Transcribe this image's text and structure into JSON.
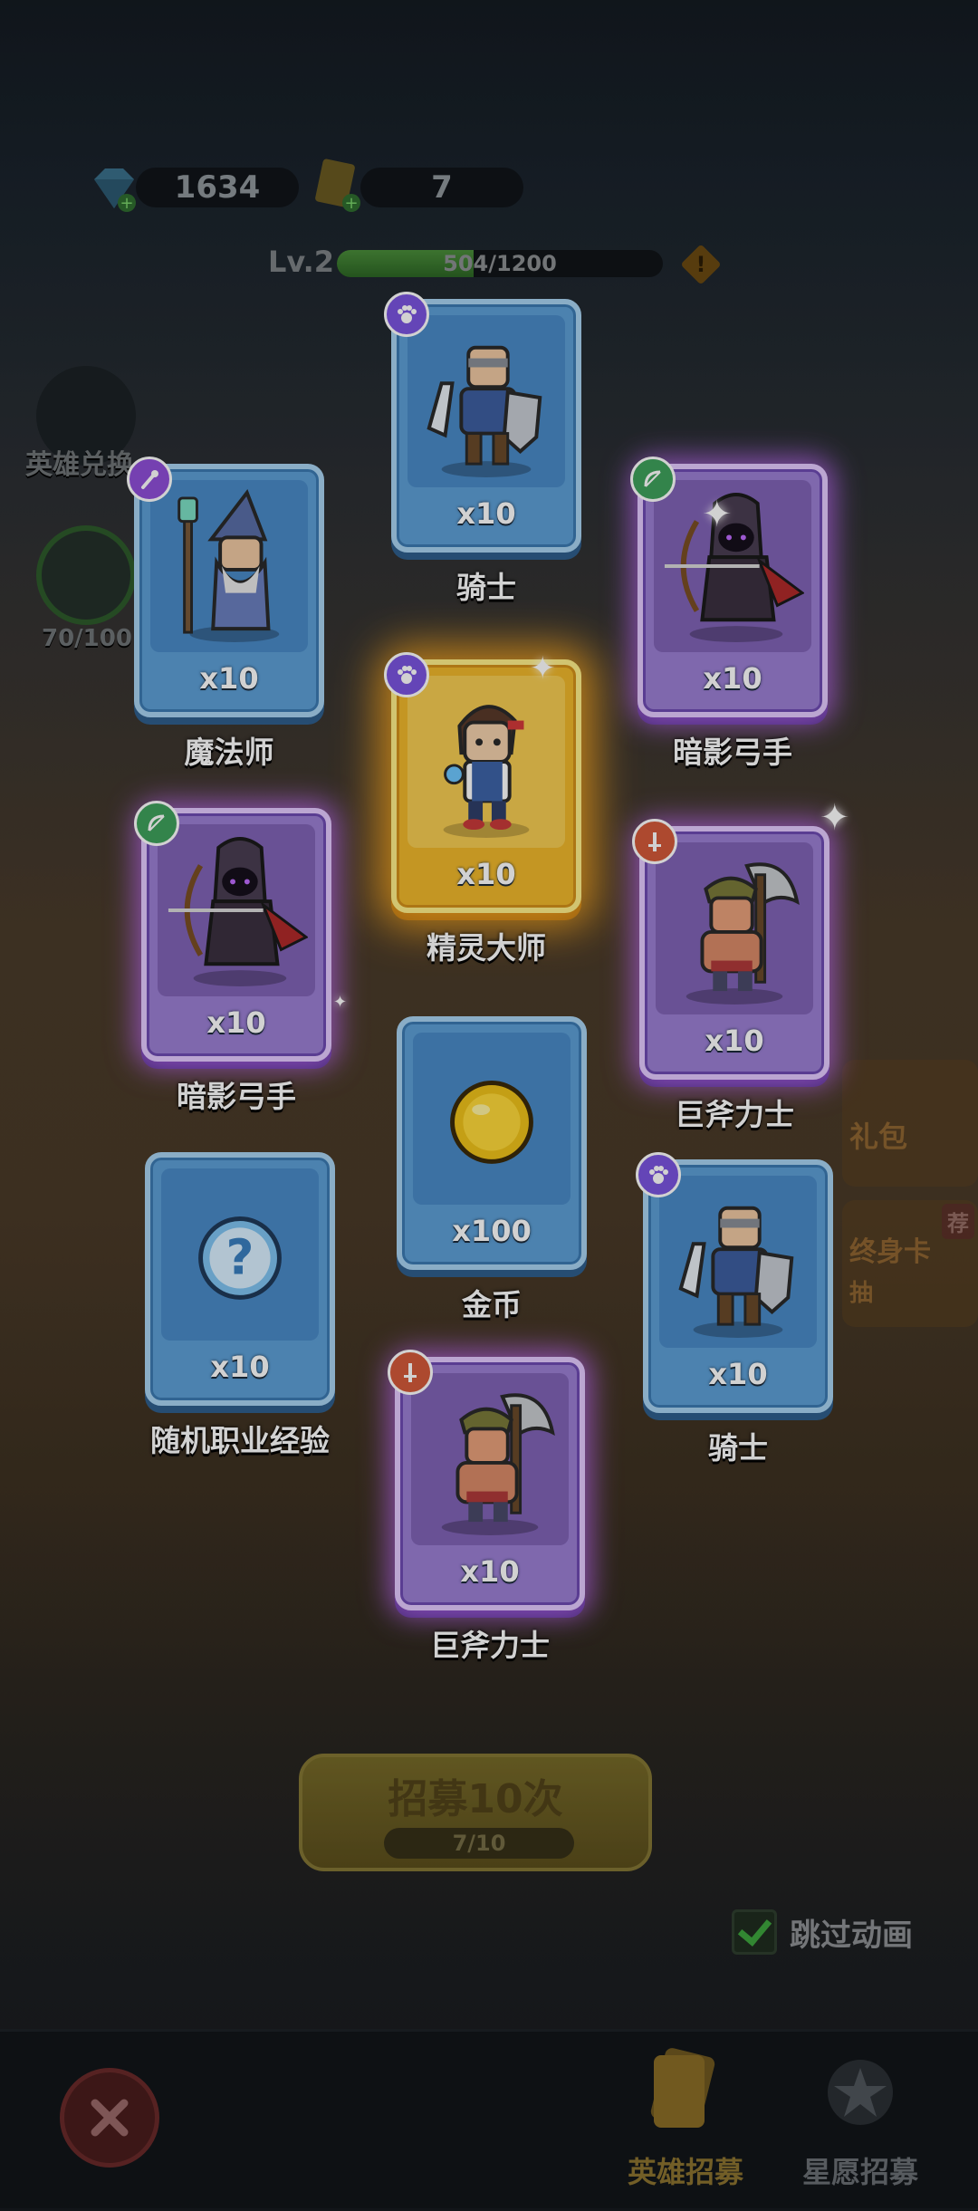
{
  "resources": {
    "gems": "1634",
    "tickets": "7"
  },
  "player": {
    "level": "Lv.2",
    "xp_text": "504/1200",
    "xp_progress": 0.42
  },
  "side": {
    "hero_exchange_label": "英雄兑换",
    "star_progress": "70/100"
  },
  "cards": [
    {
      "name": "骑士",
      "qty": "x10",
      "rarity": "blue",
      "class_icon": "paw-icon",
      "art": "knight"
    },
    {
      "name": "魔法师",
      "qty": "x10",
      "rarity": "blue",
      "class_icon": "wand-icon",
      "art": "wizard"
    },
    {
      "name": "暗影弓手",
      "qty": "x10",
      "rarity": "purple",
      "class_icon": "bow-icon",
      "art": "archer"
    },
    {
      "name": "精灵大师",
      "qty": "x10",
      "rarity": "gold",
      "class_icon": "paw-icon",
      "art": "elf-master"
    },
    {
      "name": "暗影弓手",
      "qty": "x10",
      "rarity": "purple",
      "class_icon": "bow-icon",
      "art": "archer"
    },
    {
      "name": "巨斧力士",
      "qty": "x10",
      "rarity": "purple",
      "class_icon": "sword-icon",
      "art": "axeman"
    },
    {
      "name": "金币",
      "qty": "x100",
      "rarity": "blue",
      "class_icon": "",
      "art": "coin"
    },
    {
      "name": "随机职业经验",
      "qty": "x10",
      "rarity": "blue",
      "class_icon": "",
      "art": "mystery-orb"
    },
    {
      "name": "骑士",
      "qty": "x10",
      "rarity": "blue",
      "class_icon": "paw-icon",
      "art": "knight"
    },
    {
      "name": "巨斧力士",
      "qty": "x10",
      "rarity": "purple",
      "class_icon": "sword-icon",
      "art": "axeman"
    }
  ],
  "recruit": {
    "button_label": "招募10次",
    "progress": "7/10"
  },
  "skip_animation": {
    "label": "跳过动画",
    "checked": true
  },
  "background_panels": {
    "gift_label": "礼包",
    "lifetime_card_label": "终身卡",
    "draw_label": "抽",
    "recommend_label": "荐"
  },
  "bottom_tabs": [
    {
      "label": "英雄招募",
      "icon": "card-pack-icon",
      "active": true
    },
    {
      "label": "星愿招募",
      "icon": "star-wish-icon",
      "active": false
    }
  ],
  "colors": {
    "blue_card": "#5d9fd6",
    "purple_card": "#9b7fd4",
    "gold_card": "#f0b82b",
    "active_tab": "#c9a233"
  }
}
